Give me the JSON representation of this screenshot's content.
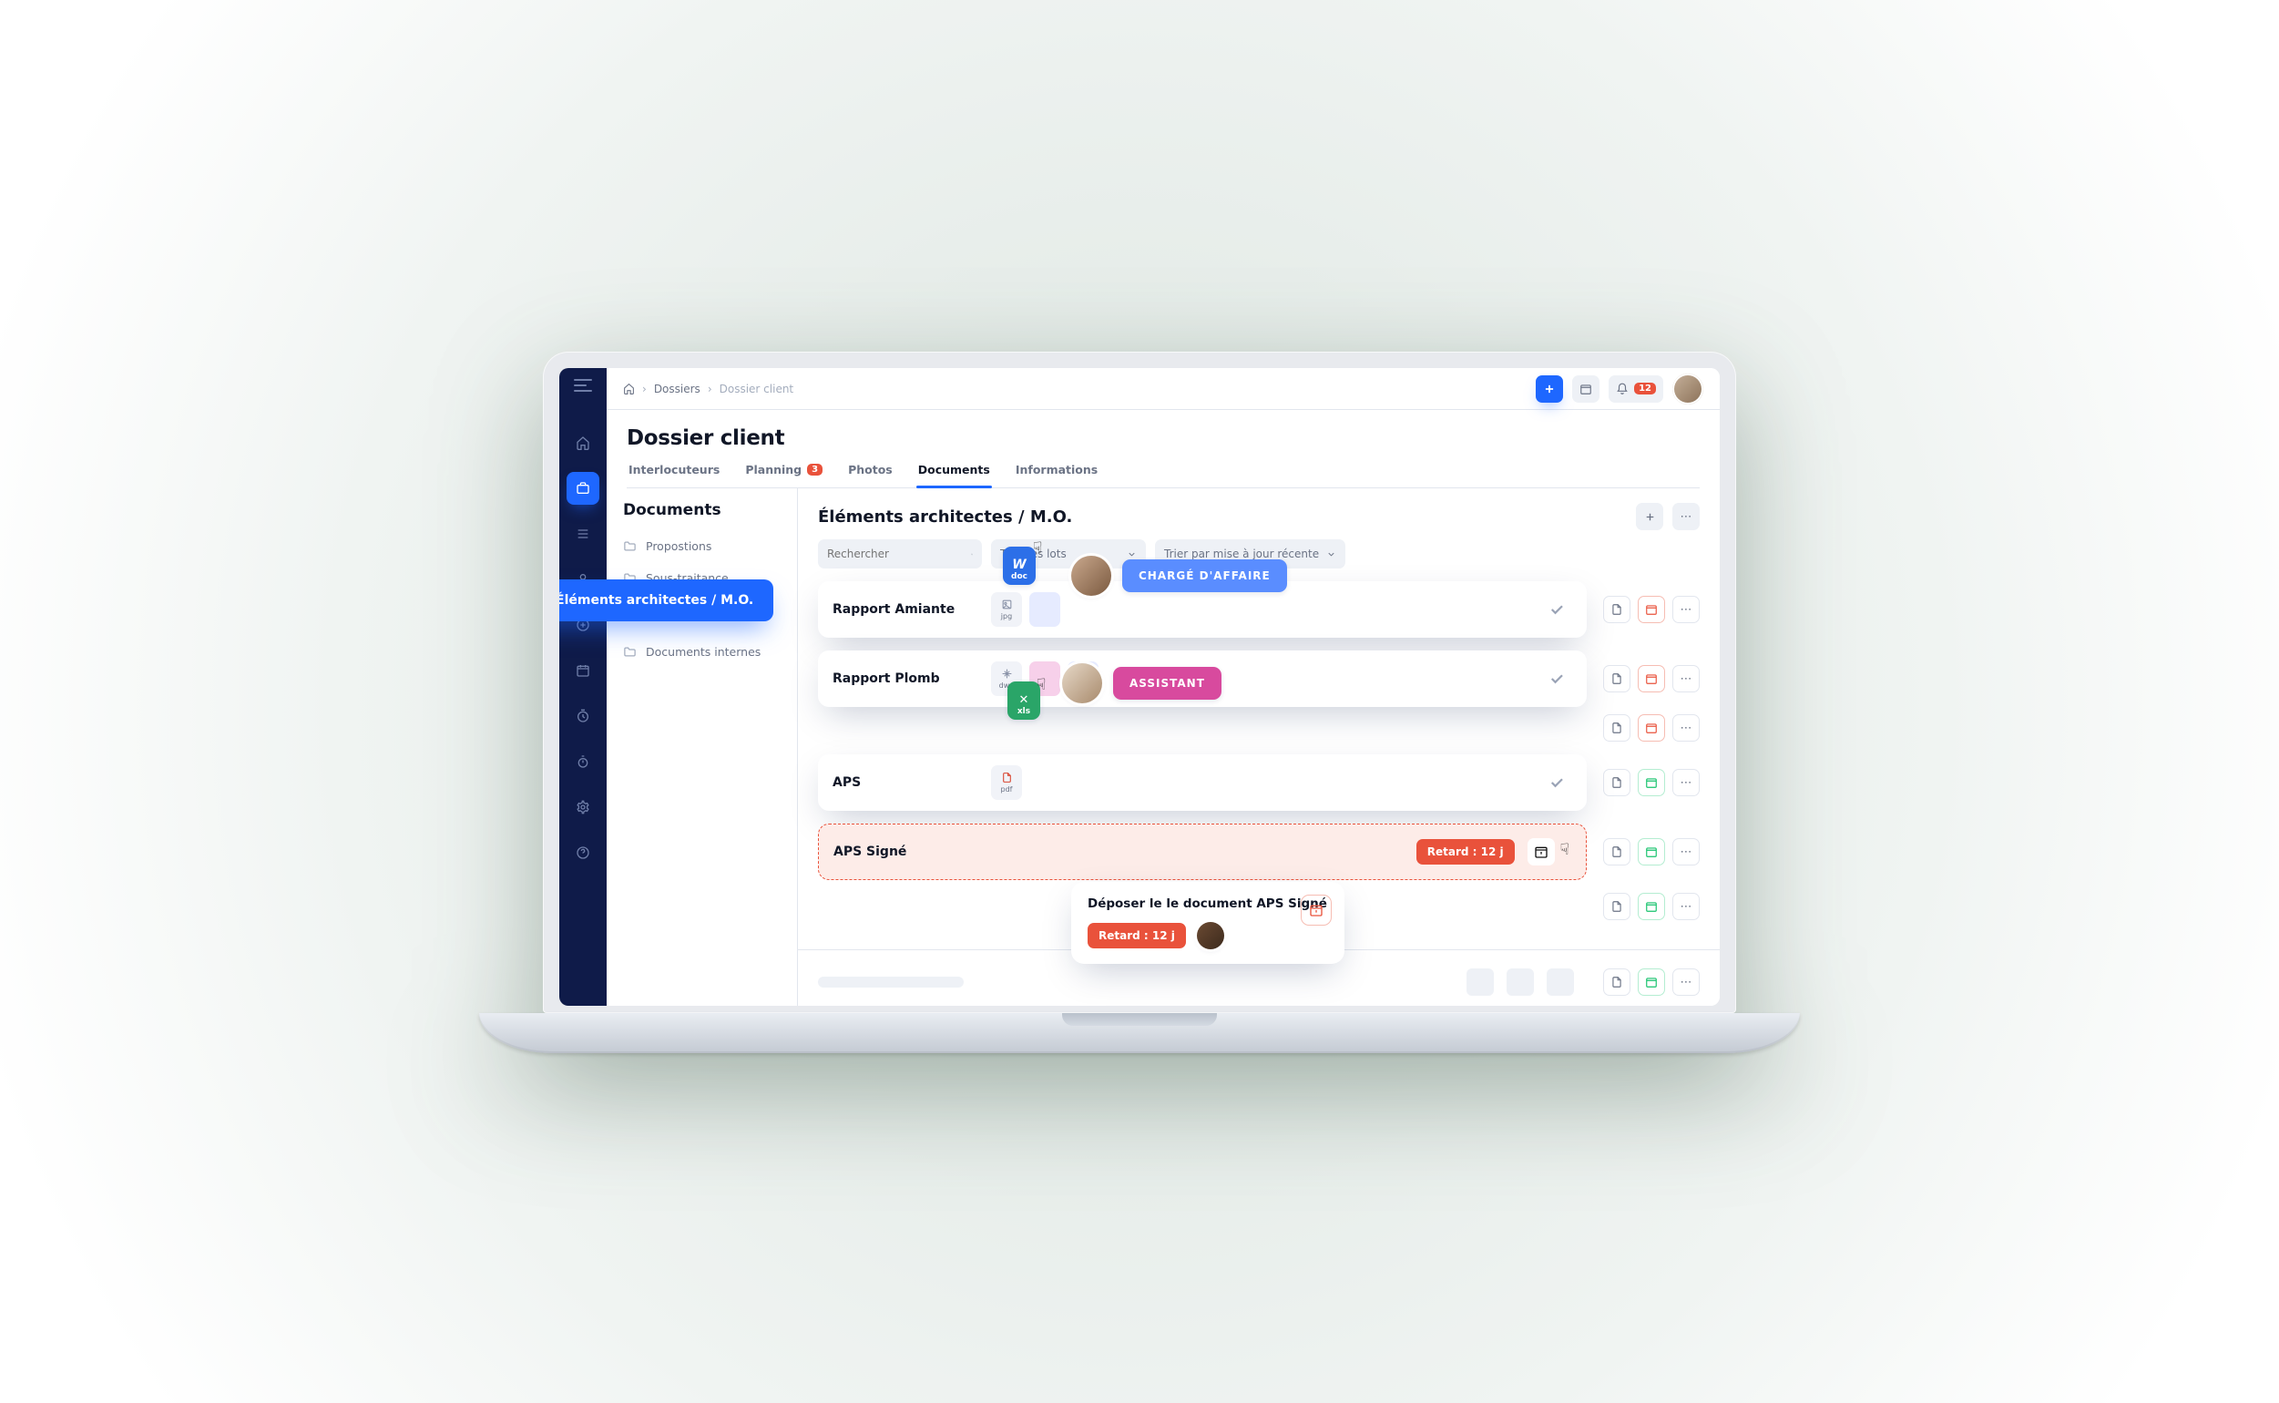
{
  "breadcrumb": {
    "root_icon": "home",
    "mid": "Dossiers",
    "now": "Dossier client"
  },
  "topbar": {
    "notif_count": "12"
  },
  "page": {
    "title": "Dossier client"
  },
  "tabs": [
    {
      "key": "interloc",
      "label": "Interlocuteurs"
    },
    {
      "key": "planning",
      "label": "Planning",
      "badge": "3"
    },
    {
      "key": "photos",
      "label": "Photos"
    },
    {
      "key": "documents",
      "label": "Documents",
      "active": true
    },
    {
      "key": "infos",
      "label": "Informations"
    }
  ],
  "side": {
    "title": "Documents",
    "folders": [
      {
        "label": "Propostions"
      },
      {
        "label": "Sous-traitance"
      },
      {
        "label": "Éléments architectes / M.O.",
        "active": true
      },
      {
        "label": "Documents internes"
      }
    ]
  },
  "content": {
    "title": "Éléments architectes / M.O.",
    "search_placeholder": "Rechercher",
    "lot_sel": "Tous les lots",
    "sort_sel": "Trier par mise à jour récente",
    "rows": [
      {
        "name": "Rapport Amiante",
        "thumbs": [
          {
            "ext": "jpg"
          },
          {
            "blank": true
          }
        ],
        "status": "done",
        "side_cal": "red"
      },
      {
        "name": "Rapport Plomb",
        "thumbs": [
          {
            "ext": "dwg"
          },
          {
            "pink": true
          },
          {
            "blank": true
          }
        ],
        "status": "done",
        "side_cal": "red"
      },
      {
        "name": "",
        "skeleton": true,
        "side_cal": "red"
      },
      {
        "name": "APS",
        "thumbs": [
          {
            "ext": "pdf"
          }
        ],
        "status": "done",
        "side_cal": "green"
      },
      {
        "name": "APS Signé",
        "danger": true,
        "late_label": "Retard : 12 j",
        "side_cal": "green"
      },
      {
        "name": "",
        "skeleton": true,
        "side_cal": "green"
      }
    ]
  },
  "roles": {
    "charge": "CHARGÉ D'AFFAIRE",
    "assistant": "ASSISTANT"
  },
  "file_drag": {
    "doc_ext": "doc",
    "xls_ext": "xls"
  },
  "popover": {
    "title": "Déposer le le document APS Signé",
    "late": "Retard : 12 j"
  }
}
